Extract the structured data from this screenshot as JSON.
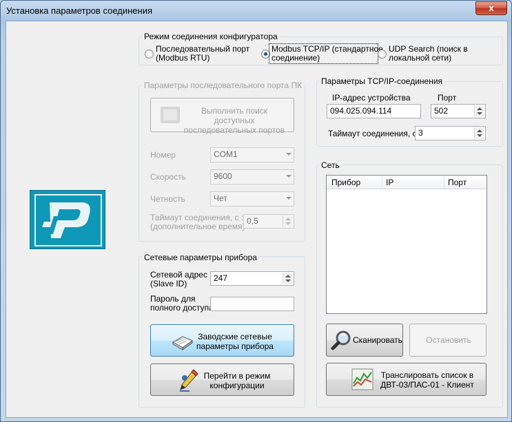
{
  "window": {
    "title": "Установка параметров соединения",
    "close_glyph": "x"
  },
  "mode": {
    "label": "Режим соединения конфигуратора",
    "options": [
      {
        "label_line1": "Последовательный порт",
        "label_line2": "(Modbus RTU)",
        "selected": false
      },
      {
        "label_line1": "Modbus TCP/IP (стандартное",
        "label_line2": "соединение)",
        "selected": true
      },
      {
        "label_line1": "UDP Search (поиск в",
        "label_line2": "локальной сети)",
        "selected": false
      }
    ]
  },
  "serial": {
    "label": "Параметры последовательного порта ПК",
    "search_button_line1": "Выполнить поиск доступных",
    "search_button_line2": "последовательных портов",
    "number_label": "Номер",
    "number_value": "COM1",
    "speed_label": "Скорость",
    "speed_value": "9600",
    "parity_label": "Четность",
    "parity_value": "Чет",
    "timeout_label_line1": "Таймаут соединения, с :",
    "timeout_label_line2": "(дополнительное время)",
    "timeout_value": "0,5"
  },
  "tcp": {
    "label": "Параметры TCP/IP-соединения",
    "ip_label": "IP-адрес устройства",
    "ip_value": "094.025.094.114",
    "port_label": "Порт",
    "port_value": "502",
    "timeout_label": "Таймаут соединения, с:",
    "timeout_value": "3"
  },
  "network": {
    "label": "Сеть",
    "columns": [
      "Прибор",
      "IP",
      "Порт"
    ],
    "rows": [],
    "scan_button": "Сканировать",
    "stop_button": "Остановить",
    "translate_button_line1": "Транслировать список в",
    "translate_button_line2": "ДВТ-03/ПАС-01 - Клиент"
  },
  "device": {
    "label": "Сетевые параметры прибора",
    "address_label_line1": "Сетевой адрес",
    "address_label_line2": "(Slave ID)",
    "address_value": "247",
    "password_label_line1": "Пароль для",
    "password_label_line2": "полного доступа",
    "password_value": "",
    "factory_button_line1": "Заводские сетевые",
    "factory_button_line2": "параметры прибора",
    "config_button_line1": "Перейти в режим",
    "config_button_line2": "конфигурации"
  },
  "colors": {
    "logo_bg": "#0f97b8",
    "accent_blue": "#3c7fb1"
  }
}
